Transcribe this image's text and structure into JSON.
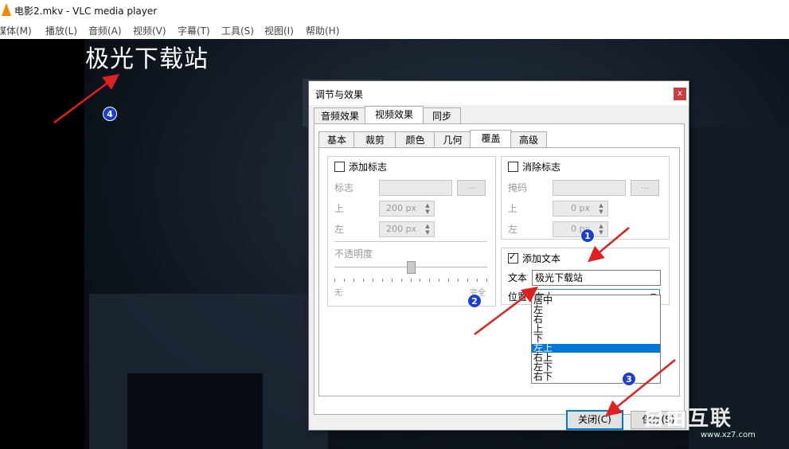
{
  "window": {
    "title": "电影2.mkv - VLC media player"
  },
  "menu": [
    {
      "label": "媒体(M)"
    },
    {
      "label": "播放(L)"
    },
    {
      "label": "音频(A)"
    },
    {
      "label": "视频(V)"
    },
    {
      "label": "字幕(T)"
    },
    {
      "label": "工具(S)"
    },
    {
      "label": "视图(I)"
    },
    {
      "label": "帮助(H)"
    }
  ],
  "video": {
    "overlay_text": "极光下载站"
  },
  "dialog": {
    "title": "调节与效果",
    "close_glyph": "x",
    "top_tabs": [
      "音频效果",
      "视频效果",
      "同步"
    ],
    "sub_tabs": [
      "基本",
      "裁剪",
      "颜色",
      "几何",
      "覆盖",
      "高级"
    ],
    "add_logo": {
      "checkbox_label": "添加标志",
      "logo_label": "标志",
      "browse": "...",
      "top_label": "上",
      "top_value": "200",
      "left_label": "左",
      "left_value": "200",
      "unit": "px",
      "opacity_label": "不透明度",
      "min_label": "无",
      "max_label": "完全",
      "opacity": 0.5
    },
    "remove_logo": {
      "checkbox_label": "消除标志",
      "mask_label": "掩码",
      "browse": "...",
      "top_label": "上",
      "top_value": "0",
      "left_label": "左",
      "left_value": "0",
      "unit": "px"
    },
    "add_text": {
      "checkbox_label": "添加文本",
      "checked": true,
      "text_label": "文本",
      "text_value": "极光下载站",
      "position_label": "位置",
      "position_value": "左上",
      "position_options": [
        "居中",
        "左",
        "右",
        "上",
        "下",
        "左上",
        "右上",
        "左下",
        "右下"
      ],
      "selected_option": "左上"
    },
    "buttons": {
      "close": "关闭(C)",
      "save": "保存(S)"
    }
  },
  "markers": [
    "1",
    "2",
    "3",
    "4"
  ],
  "watermark": {
    "brand": "自由互联",
    "url": "www.xz7.com"
  },
  "colors": {
    "marker": "#1a3fd0",
    "arrow": "#e02020",
    "selection": "#0078d7"
  }
}
